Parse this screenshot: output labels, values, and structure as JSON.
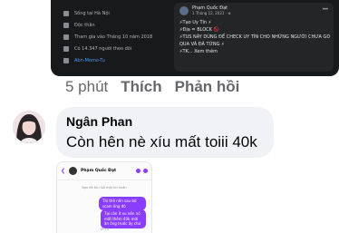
{
  "embedded_top": {
    "profile_items": [
      {
        "icon": "home-icon",
        "text": "Sống tại Hà Nội"
      },
      {
        "icon": "heart-icon",
        "text": "Độc thân"
      },
      {
        "icon": "clock-icon",
        "text": "Tham gia vào Tháng 10 năm 2018"
      },
      {
        "icon": "rss-icon",
        "text": "Có 14.347 người theo dõi"
      },
      {
        "icon": "instagram-icon",
        "text": "Abn-Momo-Tu"
      }
    ],
    "post": {
      "author": "Phạm Quốc Đạt",
      "date": "1 Tháng 12, 2021 · ⊕",
      "lines": [
        "⚡Tạo Uy Tín ⚡",
        "⚡Địa = BLOCK 🚫",
        "⚡TUS NÀY DÙNG ĐỂ CHECK UY TÍN CHO NHỮNG NGƯỜI CHƯA GD",
        "QUA VÀ ĐÃ TỪNG ⚡",
        "⚡TK... Xem thêm"
      ]
    }
  },
  "first_comment_actions": {
    "time": "5 phút",
    "like": "Thích",
    "reply": "Phản hồi"
  },
  "second_comment": {
    "author": "Ngân Phan",
    "text": "Còn hên nè xíu mất toiii 40k"
  },
  "attachment": {
    "contact": "Phạm Quốc Đạt",
    "system_line": "Bạn đã thu hồi một tin nhắn",
    "messages": [
      "Thì thế nên sau bữ scam ông đó",
      "Tại còn ít xu nên nó mất thêm 40k mới ăn ông trước ấy chứ"
    ],
    "time": "13:13"
  }
}
